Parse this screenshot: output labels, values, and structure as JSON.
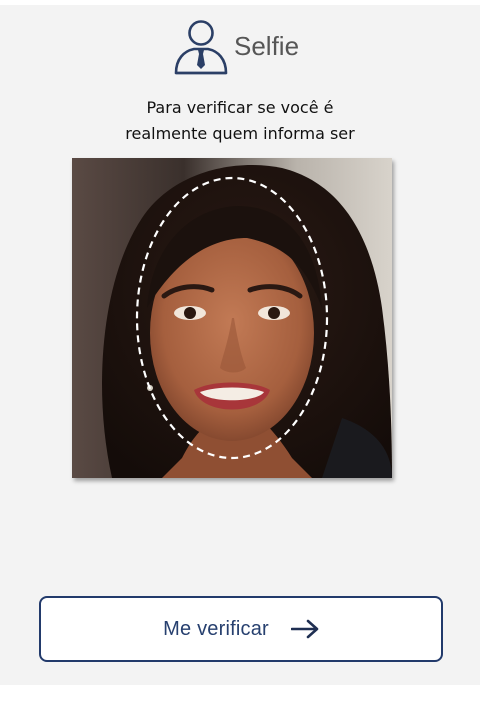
{
  "header": {
    "icon": "user-with-tie-icon",
    "title": "Selfie"
  },
  "instructions": {
    "line1": "Para verificar se você é",
    "line2": "realmente quem informa ser"
  },
  "photo": {
    "description_icon": "selfie-photo",
    "face_guide": "dashed-oval-face-guide"
  },
  "verify_button": {
    "label": "Me verificar",
    "icon": "arrow-right-icon"
  },
  "colors": {
    "accent": "#223a6b",
    "background": "#f3f3f3",
    "icon": "#2b3f66",
    "title": "#565656"
  }
}
